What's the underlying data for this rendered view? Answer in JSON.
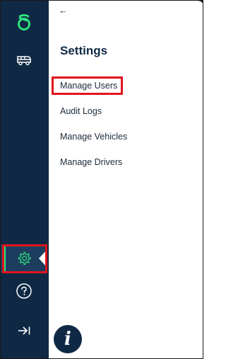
{
  "sidebar": {
    "logo_icon": "brand-logo-icon",
    "items": [
      {
        "name": "vehicles",
        "icon": "van-icon",
        "active": false
      },
      {
        "name": "settings",
        "icon": "gear-icon",
        "active": true
      },
      {
        "name": "help",
        "icon": "help-circle-icon",
        "active": false
      },
      {
        "name": "collapse",
        "icon": "collapse-arrow-icon",
        "active": false
      }
    ],
    "active_accent_color": "#2fe07f",
    "background_color": "#0f2945"
  },
  "header": {
    "back_label": "←"
  },
  "main": {
    "title": "Settings",
    "menu": [
      {
        "label": "Manage Users",
        "highlighted": true
      },
      {
        "label": "Audit Logs",
        "highlighted": false
      },
      {
        "label": "Manage Vehicles",
        "highlighted": false
      },
      {
        "label": "Manage Drivers",
        "highlighted": false
      }
    ]
  },
  "info_button": {
    "label": "i",
    "icon": "info-icon"
  },
  "highlight_color": "#e1141c"
}
